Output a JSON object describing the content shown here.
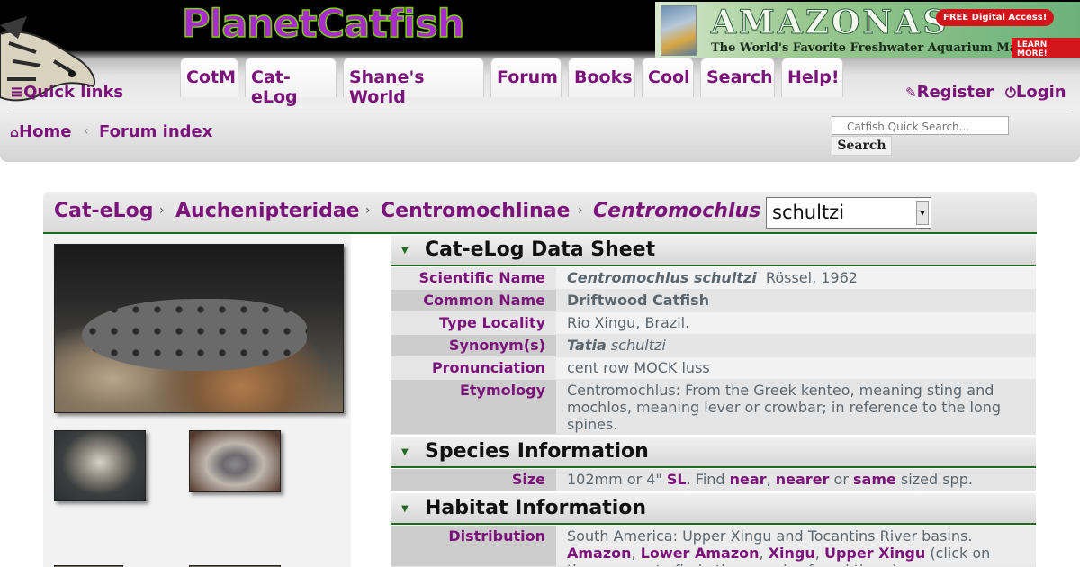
{
  "header": {
    "logo": "PlanetCatfish",
    "banner": {
      "title": "AMAZONAS",
      "tagline": "The World's Favorite Freshwater Aquarium Magazine!",
      "free_badge": "FREE Digital Access!",
      "learn_more": "LEARN MORE!"
    },
    "tabs": [
      "CotM",
      "Cat-eLog",
      "Shane's World",
      "Forum",
      "Books",
      "Cool",
      "Search",
      "Help!"
    ],
    "quick_links": "Quick links",
    "register": "Register",
    "login": "Login",
    "breadcrumb": {
      "home": "Home",
      "forum_index": "Forum index"
    },
    "search": {
      "placeholder": "Catfish Quick Search...",
      "button": "Search"
    }
  },
  "crumbs": [
    "Cat-eLog",
    "Auchenipteridae",
    "Centromochlinae",
    "Centromochlus"
  ],
  "species_select": "schultzi",
  "sections": {
    "data_sheet": "Cat-eLog Data Sheet",
    "species_info": "Species Information",
    "habitat_info": "Habitat Information"
  },
  "data_sheet": {
    "scientific_name": {
      "label": "Scientific Name",
      "genus_species": "Centromochlus schultzi",
      "author": "Rössel, 1962"
    },
    "common_name": {
      "label": "Common Name",
      "value": "Driftwood Catfish"
    },
    "type_locality": {
      "label": "Type Locality",
      "value": "Rio Xingu, Brazil."
    },
    "synonyms": {
      "label": "Synonym(s)",
      "genus": "Tatia",
      "species": "schultzi"
    },
    "pronunciation": {
      "label": "Pronunciation",
      "value": "cent row MOCK luss"
    },
    "etymology": {
      "label": "Etymology",
      "value": "Centromochlus: From the Greek kenteo, meaning sting and mochlos, meaning lever or crowbar; in reference to the long spines."
    }
  },
  "species_info": {
    "size": {
      "label": "Size",
      "prefix": "102mm or 4\"",
      "sl": "SL",
      "find": ". Find",
      "near": "near",
      "nearer": "nearer",
      "or": "or",
      "same": "same",
      "suffix": "sized spp."
    }
  },
  "habitat_info": {
    "distribution": {
      "label": "Distribution",
      "text": "South America: Upper Xingu and Tocantins River basins.",
      "areas": [
        "Amazon",
        "Lower Amazon",
        "Xingu",
        "Upper Xingu"
      ],
      "note": "(click on these areas to find other species found there)"
    }
  },
  "colors": {
    "link": "#7b137b",
    "accent_line": "#1f6a1f",
    "header_black": "#000000"
  }
}
